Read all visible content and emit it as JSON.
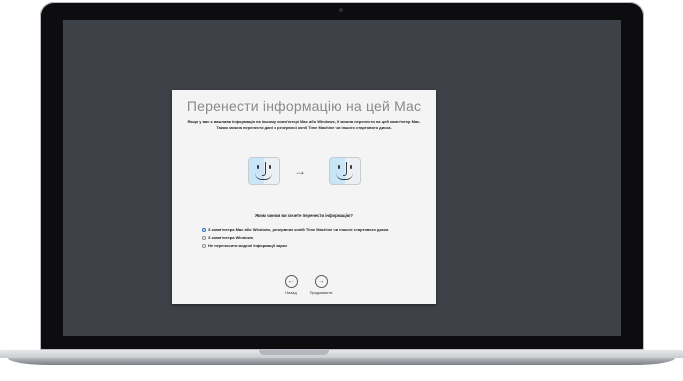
{
  "dialog": {
    "title": "Перенести інформацію на цей Mac",
    "subtitle": "Якщо у вас є важлива інформація на іншому комп'ютері Mac або Windows, її можна перенести на цей комп'ютер Mac. Також можна перенести дані з резервної копії Time Machine чи іншого стартового диска.",
    "question": "Яким чином ви хочете перенести інформацію?",
    "options": [
      {
        "label": "З комп'ютера Mac або Windows, резервних копій Time Machine чи іншого стартового диска",
        "selected": true
      },
      {
        "label": "З комп'ютера Windows",
        "selected": false
      },
      {
        "label": "Не переносити жодної інформації зараз",
        "selected": false
      }
    ],
    "back_label": "Назад",
    "continue_label": "Продовжити"
  },
  "icons": {
    "source": "finder-icon",
    "arrow": "arrow-right-icon",
    "target": "finder-icon",
    "back": "arrow-left-circle-icon",
    "continue": "arrow-right-circle-icon"
  },
  "colors": {
    "screen_background": "#3f4148",
    "dialog_background": "#f4f4f4",
    "selected_radio": "#3a8de0"
  }
}
